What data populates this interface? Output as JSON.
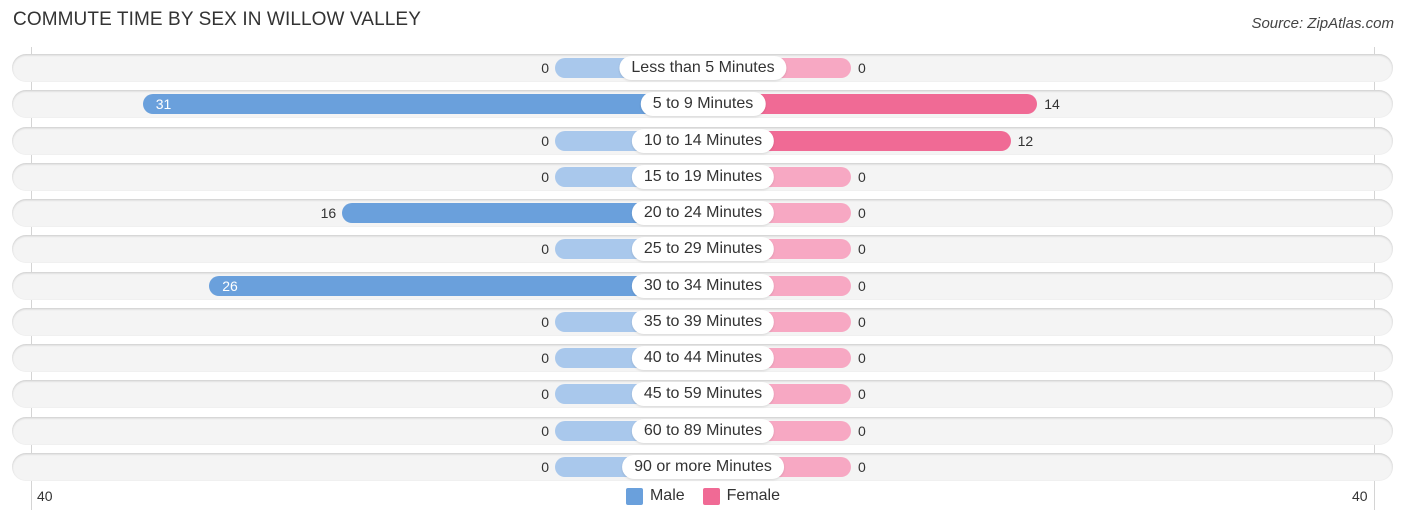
{
  "chart_data": {
    "type": "bar",
    "orientation": "horizontal-diverging",
    "title": "COMMUTE TIME BY SEX IN WILLOW VALLEY",
    "source": "Source: ZipAtlas.com",
    "categories": [
      "Less than 5 Minutes",
      "5 to 9 Minutes",
      "10 to 14 Minutes",
      "15 to 19 Minutes",
      "20 to 24 Minutes",
      "25 to 29 Minutes",
      "30 to 34 Minutes",
      "35 to 39 Minutes",
      "40 to 44 Minutes",
      "45 to 59 Minutes",
      "60 to 89 Minutes",
      "90 or more Minutes"
    ],
    "series": [
      {
        "name": "Male",
        "color": "#6aa0dc",
        "values": [
          0,
          31,
          0,
          0,
          16,
          0,
          26,
          0,
          0,
          0,
          0,
          0
        ]
      },
      {
        "name": "Female",
        "color": "#f06a95",
        "values": [
          0,
          14,
          12,
          0,
          0,
          0,
          0,
          0,
          0,
          0,
          0,
          0
        ]
      }
    ],
    "xlim": [
      40,
      40
    ],
    "axis_ticks": {
      "left": "40",
      "right": "40"
    },
    "legend": {
      "position": "bottom-center",
      "entries": [
        "Male",
        "Female"
      ]
    },
    "grid": false
  },
  "colors": {
    "male": "#6aa0dc",
    "male_zero": "#a9c8ec",
    "female": "#f06a95",
    "female_zero": "#f7a8c3"
  }
}
